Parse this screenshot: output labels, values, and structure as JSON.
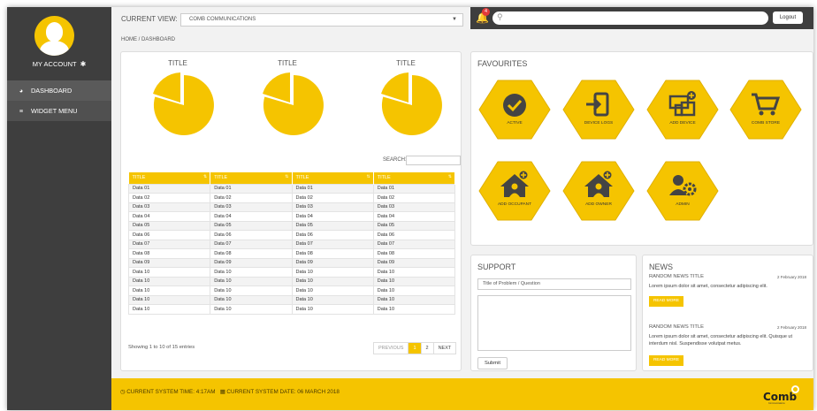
{
  "sidebar": {
    "account_label": "MY ACCOUNT",
    "nav": [
      {
        "label": "DASHBOARD",
        "icon": "gauge-icon"
      },
      {
        "label": "WIDGET MENU",
        "icon": "hamburger-icon"
      }
    ]
  },
  "header": {
    "current_view_label": "CURRENT VIEW:",
    "current_view_value": "COMB COMMUNICATIONS",
    "notification_count": "4",
    "logout_label": "Logout",
    "breadcrumb": "HOME / DASHBOARD"
  },
  "charts": [
    {
      "title": "TITLE"
    },
    {
      "title": "TITLE"
    },
    {
      "title": "TITLE"
    }
  ],
  "table": {
    "search_label": "SEARCH:",
    "headers": [
      "TITLE",
      "TITLE",
      "TITLE",
      "TITLE"
    ],
    "rows": [
      [
        "Data 01",
        "Data 01",
        "Data 01",
        "Data 01"
      ],
      [
        "Data 02",
        "Data 02",
        "Data 02",
        "Data 02"
      ],
      [
        "Data 03",
        "Data 03",
        "Data 03",
        "Data 03"
      ],
      [
        "Data 04",
        "Data 04",
        "Data 04",
        "Data 04"
      ],
      [
        "Data 05",
        "Data 05",
        "Data 05",
        "Data 05"
      ],
      [
        "Data 06",
        "Data 06",
        "Data 06",
        "Data 06"
      ],
      [
        "Data 07",
        "Data 07",
        "Data 07",
        "Data 07"
      ],
      [
        "Data 08",
        "Data 08",
        "Data 08",
        "Data 08"
      ],
      [
        "Data 09",
        "Data 09",
        "Data 09",
        "Data 09"
      ],
      [
        "Data 10",
        "Data 10",
        "Data 10",
        "Data 10"
      ],
      [
        "Data 10",
        "Data 10",
        "Data 10",
        "Data 10"
      ],
      [
        "Data 10",
        "Data 10",
        "Data 10",
        "Data 10"
      ],
      [
        "Data 10",
        "Data 10",
        "Data 10",
        "Data 10"
      ],
      [
        "Data 10",
        "Data 10",
        "Data 10",
        "Data 10"
      ]
    ],
    "showing": "Showing 1 to 10 of 15 entries",
    "pager": {
      "prev": "PREVIOUS",
      "current": "1",
      "next_page": "2",
      "next": "NEXT"
    }
  },
  "favourites": {
    "title": "FAVOURITES",
    "items": [
      {
        "label": "ACTIVE",
        "icon": "check-circle-icon"
      },
      {
        "label": "DEVICE LOGS",
        "icon": "sign-in-icon"
      },
      {
        "label": "ADD DEVICE",
        "icon": "add-device-icon"
      },
      {
        "label": "COMB STORE",
        "icon": "cart-icon"
      },
      {
        "label": "ADD OCCUPANT",
        "icon": "add-occupant-icon"
      },
      {
        "label": "ADD OWNER",
        "icon": "add-owner-icon"
      },
      {
        "label": "ADMIN",
        "icon": "admin-gear-icon"
      }
    ]
  },
  "support": {
    "title": "SUPPORT",
    "field_value": "Title of Problem / Question",
    "submit_label": "Submit"
  },
  "news": {
    "title": "NEWS",
    "items": [
      {
        "title": "RANDOM NEWS TITLE",
        "date": "2 February 2018",
        "body": "Lorem ipsum dolor sit amet, consectetur adipiscing elit.",
        "button": "READ MORE"
      },
      {
        "title": "RANDOM NEWS TITLE",
        "date": "2 February 2018",
        "body": "Lorem ipsum dolor sit amet, consectetur adipiscing elit. Quisque ut interdum nisl. Suspendisse volutpat metus.",
        "button": "READ MORE"
      }
    ]
  },
  "footer": {
    "time_label": "CURRENT SYSTEM TIME:",
    "time_value": "4:17AM",
    "date_label": "CURRENT SYSTEM DATE:",
    "date_value": "06 MARCH 2018",
    "logo_text": "Comb",
    "logo_tagline": "Communications"
  },
  "colors": {
    "accent": "#f5c400",
    "sidebar": "#3e3e3e",
    "badge": "#e23b3b"
  }
}
